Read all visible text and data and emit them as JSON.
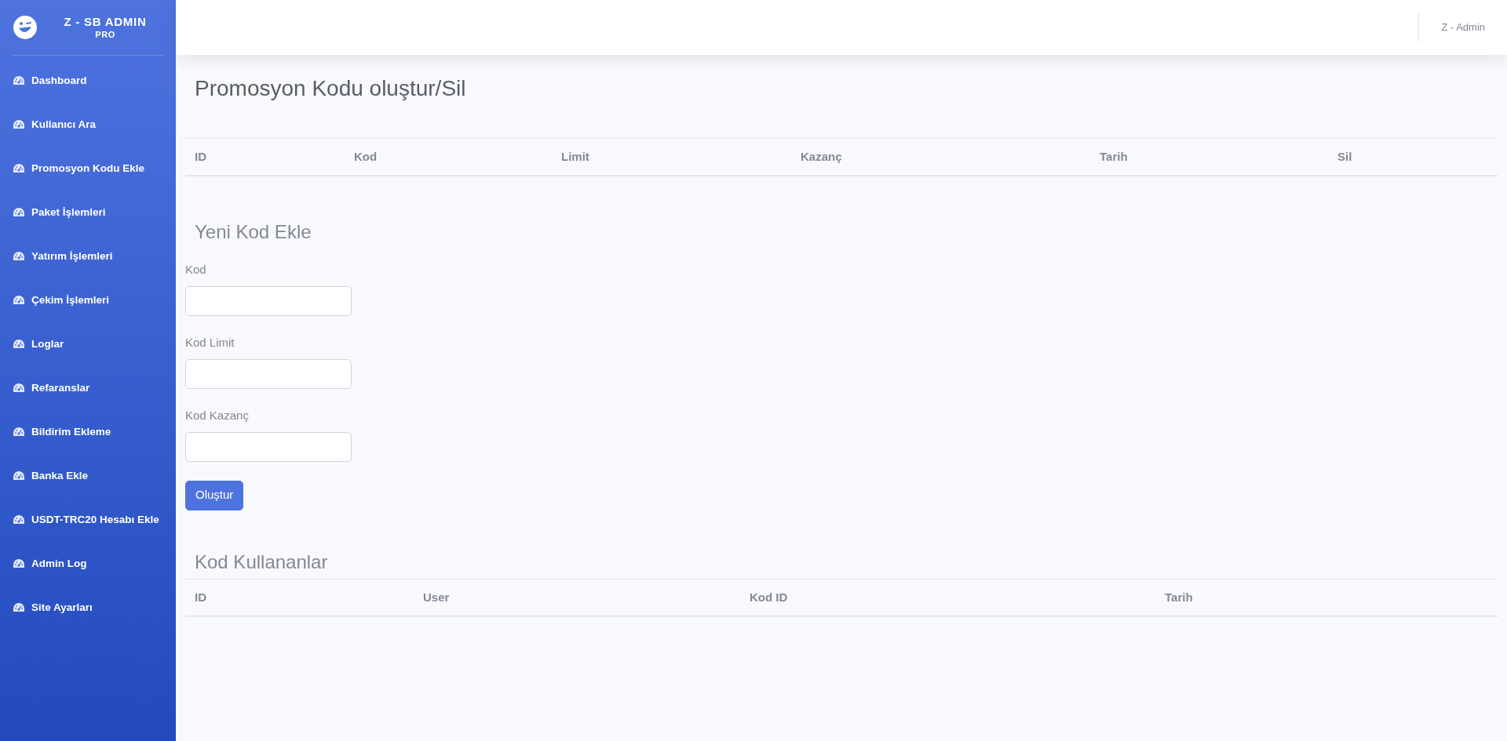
{
  "sidebar": {
    "brand": {
      "title": "Z - SB ADMIN",
      "subtitle": "PRO"
    },
    "items": [
      {
        "label": "Dashboard"
      },
      {
        "label": "Kullanıcı Ara"
      },
      {
        "label": "Promosyon Kodu Ekle"
      },
      {
        "label": "Paket İşlemleri"
      },
      {
        "label": "Yatırım İşlemleri"
      },
      {
        "label": "Çekim İşlemleri"
      },
      {
        "label": "Loglar"
      },
      {
        "label": "Refaranslar"
      },
      {
        "label": "Bildirim Ekleme"
      },
      {
        "label": "Banka Ekle"
      },
      {
        "label": "USDT-TRC20 Hesabı Ekle"
      },
      {
        "label": "Admin Log"
      },
      {
        "label": "Site Ayarları"
      }
    ]
  },
  "topbar": {
    "user": "Z - Admin"
  },
  "page_title": "Promosyon Kodu oluştur/Sil",
  "codes_table": {
    "columns": [
      "ID",
      "Kod",
      "Limit",
      "Kazanç",
      "Tarih",
      "Sil"
    ]
  },
  "new_code_form": {
    "title": "Yeni Kod Ekle",
    "fields": [
      {
        "label": "Kod"
      },
      {
        "label": "Kod Limit"
      },
      {
        "label": "Kod Kazanç"
      }
    ],
    "submit": "Oluştur"
  },
  "users_section": {
    "title": "Kod Kullananlar",
    "columns": [
      "ID",
      "User",
      "Kod ID",
      "Tarih"
    ]
  }
}
